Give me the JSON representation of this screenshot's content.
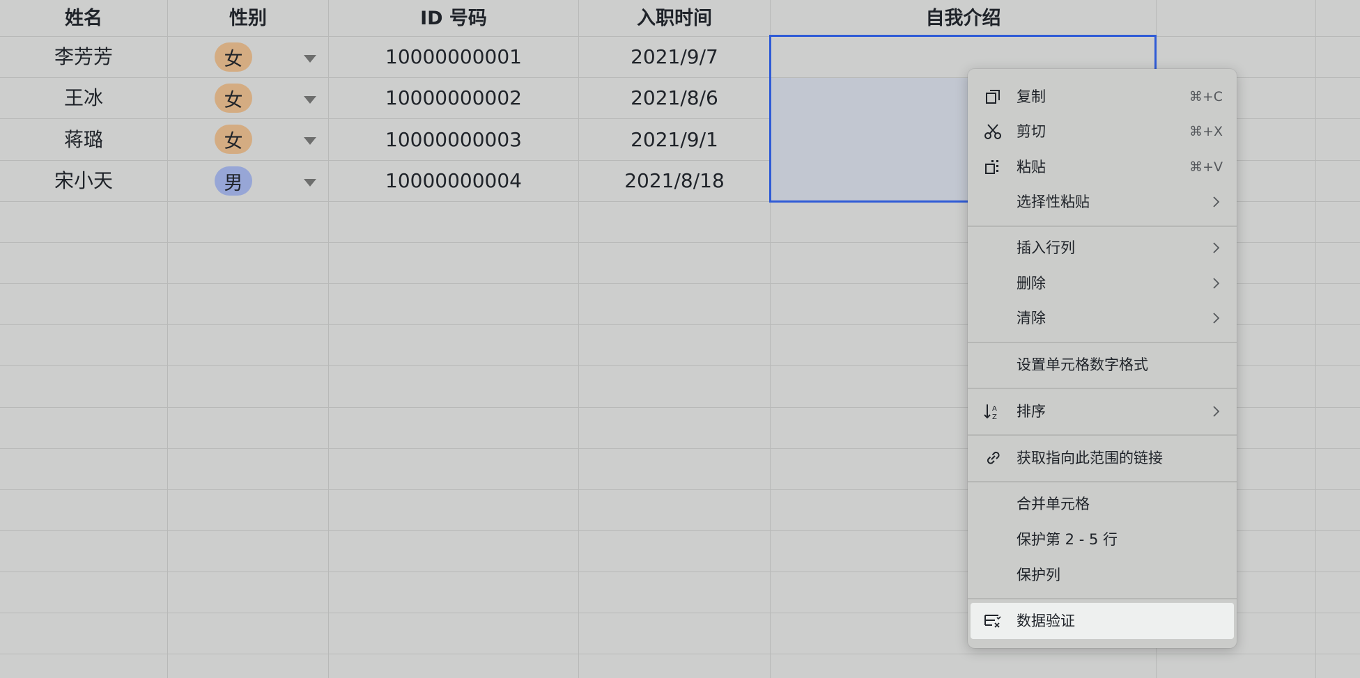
{
  "columns": [
    "姓名",
    "性别",
    "ID 号码",
    "入职时间",
    "自我介绍"
  ],
  "rows": [
    {
      "name": "李芳芳",
      "gender": "女",
      "id": "10000000001",
      "date": "2021/9/7"
    },
    {
      "name": "王冰",
      "gender": "女",
      "id": "10000000002",
      "date": "2021/8/6"
    },
    {
      "name": "蒋璐",
      "gender": "女",
      "id": "10000000003",
      "date": "2021/9/1"
    },
    {
      "name": "宋小天",
      "gender": "男",
      "id": "10000000004",
      "date": "2021/8/18"
    }
  ],
  "tag_colors": {
    "女": "#d4ac82",
    "男": "#97a6d6"
  },
  "selection_color": "#2f5bd6",
  "context_menu": {
    "copy": {
      "label": "复制",
      "shortcut": "⌘+C",
      "icon": "copy-icon"
    },
    "cut": {
      "label": "剪切",
      "shortcut": "⌘+X",
      "icon": "scissors-icon"
    },
    "paste": {
      "label": "粘贴",
      "shortcut": "⌘+V",
      "icon": "paste-icon"
    },
    "paste_special": {
      "label": "选择性粘贴"
    },
    "insert": {
      "label": "插入行列"
    },
    "delete": {
      "label": "删除"
    },
    "clear": {
      "label": "清除"
    },
    "number_format": {
      "label": "设置单元格数字格式"
    },
    "sort": {
      "label": "排序",
      "icon": "sort-icon"
    },
    "link": {
      "label": "获取指向此范围的链接",
      "icon": "link-icon"
    },
    "merge": {
      "label": "合并单元格"
    },
    "protect_rows": {
      "label": "保护第 2 - 5 行"
    },
    "protect_cols": {
      "label": "保护列"
    },
    "validation": {
      "label": "数据验证",
      "icon": "data-validation-icon"
    }
  }
}
